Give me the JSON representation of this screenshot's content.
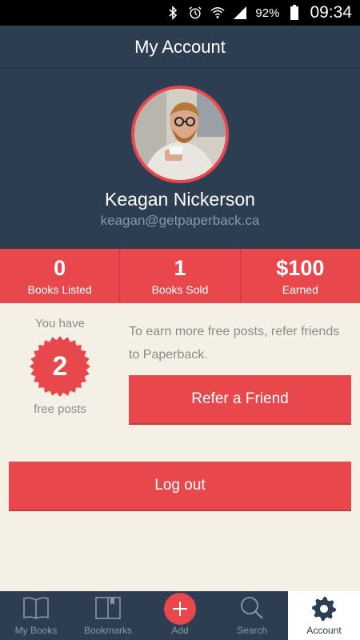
{
  "status_bar": {
    "battery_percent": "92%",
    "time": "09:34",
    "icons": [
      "bluetooth-icon",
      "alarm-icon",
      "wifi-icon",
      "signal-icon",
      "battery-icon"
    ]
  },
  "header": {
    "title": "My Account"
  },
  "profile": {
    "name": "Keagan Nickerson",
    "email": "keagan@getpaperback.ca"
  },
  "stats": [
    {
      "value": "0",
      "label": "Books Listed"
    },
    {
      "value": "1",
      "label": "Books Sold"
    },
    {
      "value": "$100",
      "label": "Earned"
    }
  ],
  "free_posts": {
    "prefix": "You have",
    "count": "2",
    "suffix": "free posts"
  },
  "refer": {
    "text": "To earn more free posts, refer friends to Paperback.",
    "button_label": "Refer a Friend"
  },
  "logout_label": "Log out",
  "tabs": [
    {
      "label": "My Books",
      "icon": "book-icon"
    },
    {
      "label": "Bookmarks",
      "icon": "bookmark-icon"
    },
    {
      "label": "Add",
      "icon": "plus-icon"
    },
    {
      "label": "Search",
      "icon": "search-icon"
    },
    {
      "label": "Account",
      "icon": "gear-icon",
      "active": true
    }
  ],
  "colors": {
    "navy": "#2d3e52",
    "accent_red": "#e8474c",
    "background": "#f4f0e6",
    "muted_text": "#8a8a8a"
  }
}
